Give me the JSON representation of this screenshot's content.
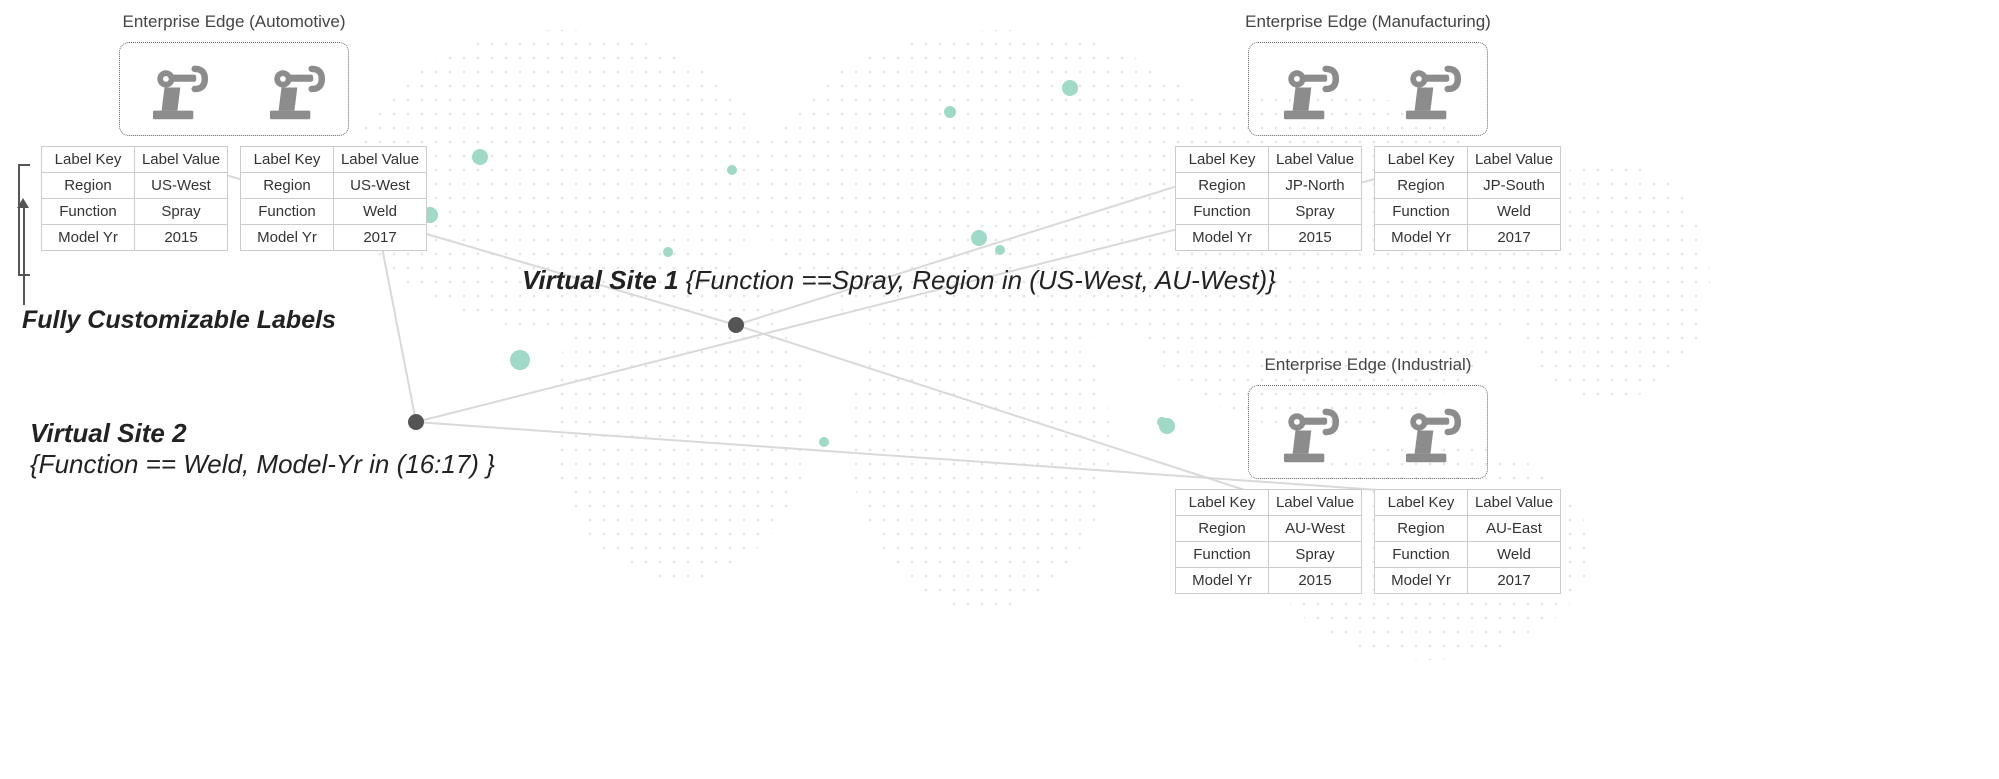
{
  "edges": {
    "auto": {
      "title": "Enterprise Edge (Automotive)",
      "robots": [
        {
          "headers": [
            "Label Key",
            "Label Value"
          ],
          "rows": [
            [
              "Region",
              "US-West"
            ],
            [
              "Function",
              "Spray"
            ],
            [
              "Model Yr",
              "2015"
            ]
          ]
        },
        {
          "headers": [
            "Label Key",
            "Label Value"
          ],
          "rows": [
            [
              "Region",
              "US-West"
            ],
            [
              "Function",
              "Weld"
            ],
            [
              "Model Yr",
              "2017"
            ]
          ]
        }
      ]
    },
    "mfg": {
      "title": "Enterprise Edge (Manufacturing)",
      "robots": [
        {
          "headers": [
            "Label Key",
            "Label Value"
          ],
          "rows": [
            [
              "Region",
              "JP-North"
            ],
            [
              "Function",
              "Spray"
            ],
            [
              "Model Yr",
              "2015"
            ]
          ]
        },
        {
          "headers": [
            "Label Key",
            "Label Value"
          ],
          "rows": [
            [
              "Region",
              "JP-South"
            ],
            [
              "Function",
              "Weld"
            ],
            [
              "Model Yr",
              "2017"
            ]
          ]
        }
      ]
    },
    "ind": {
      "title": "Enterprise Edge (Industrial)",
      "robots": [
        {
          "headers": [
            "Label Key",
            "Label Value"
          ],
          "rows": [
            [
              "Region",
              "AU-West"
            ],
            [
              "Function",
              "Spray"
            ],
            [
              "Model Yr",
              "2015"
            ]
          ]
        },
        {
          "headers": [
            "Label Key",
            "Label Value"
          ],
          "rows": [
            [
              "Region",
              "AU-East"
            ],
            [
              "Function",
              "Weld"
            ],
            [
              "Model Yr",
              "2017"
            ]
          ]
        }
      ]
    }
  },
  "virtualSites": {
    "v1": {
      "label": "Virtual Site 1",
      "expr": "{Function ==Spray,  Region in (US-West,  AU-West)}"
    },
    "v2": {
      "label": "Virtual Site 2",
      "expr": "{Function == Weld, Model-Yr in (16:17) }"
    }
  },
  "callout": "Fully Customizable Labels"
}
